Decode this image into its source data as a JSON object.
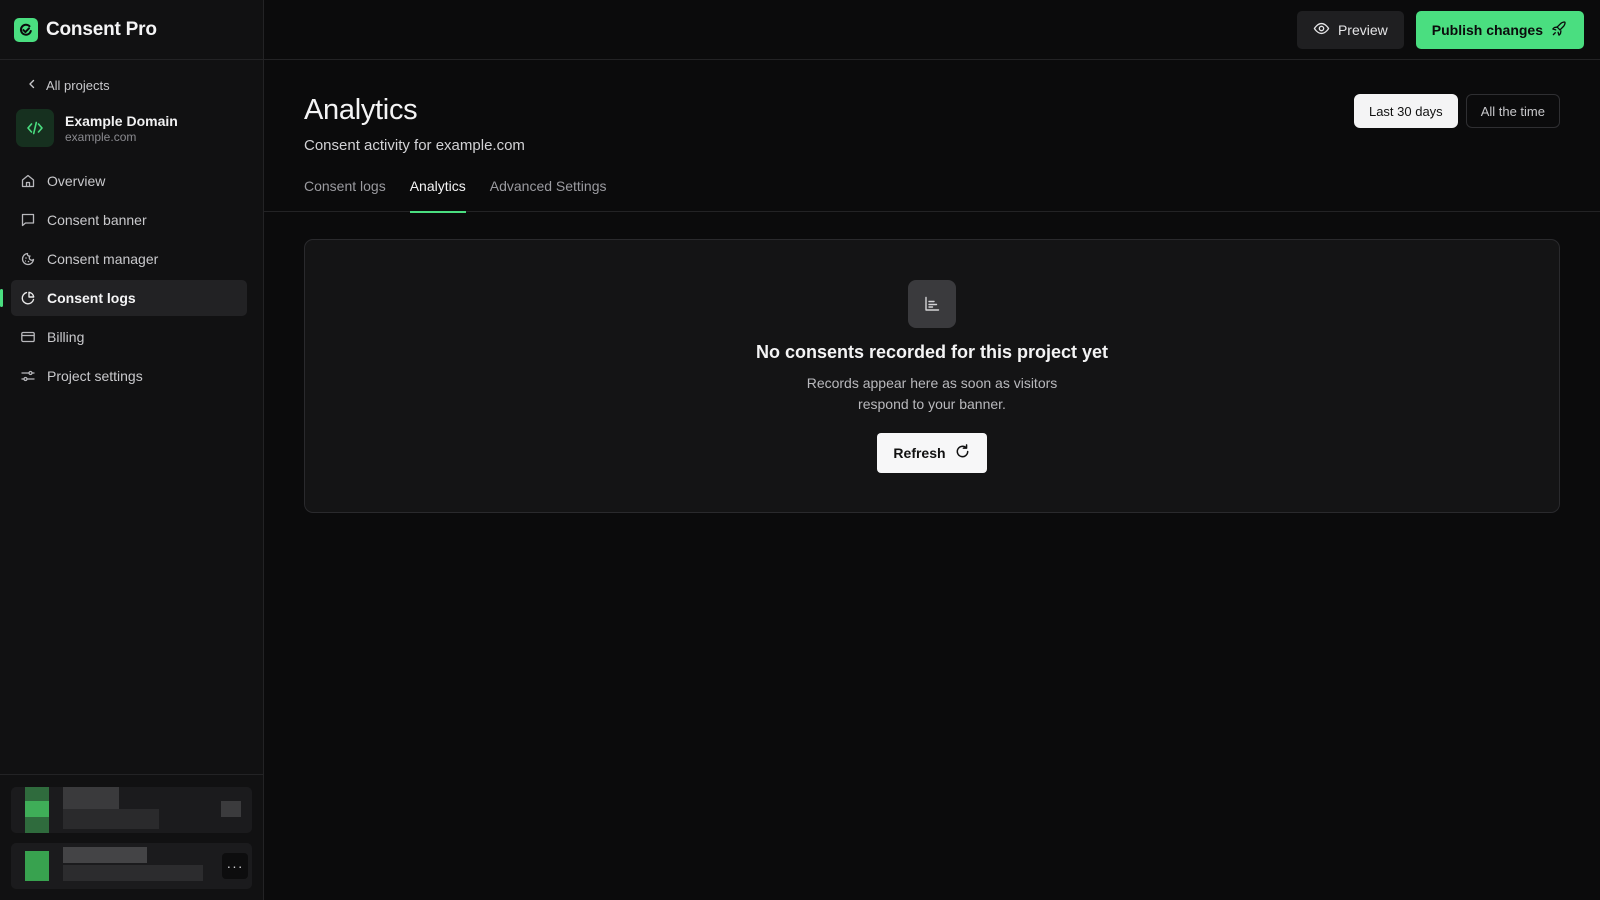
{
  "app": {
    "name": "Consent Pro"
  },
  "sidebar": {
    "back_label": "All projects",
    "project": {
      "name": "Example Domain",
      "domain": "example.com"
    },
    "items": [
      {
        "label": "Overview",
        "icon": "home-icon",
        "active": false
      },
      {
        "label": "Consent banner",
        "icon": "message-square-icon",
        "active": false
      },
      {
        "label": "Consent manager",
        "icon": "cookie-icon",
        "active": false
      },
      {
        "label": "Consent logs",
        "icon": "pie-chart-icon",
        "active": true
      },
      {
        "label": "Billing",
        "icon": "credit-card-icon",
        "active": false
      },
      {
        "label": "Project settings",
        "icon": "sliders-icon",
        "active": false
      }
    ],
    "footer": {
      "more_label": "···"
    }
  },
  "topbar": {
    "preview_label": "Preview",
    "publish_label": "Publish changes"
  },
  "header": {
    "title": "Analytics",
    "subtitle": "Consent activity for example.com",
    "ranges": [
      {
        "label": "Last 30 days",
        "selected": true
      },
      {
        "label": "All the time",
        "selected": false
      }
    ]
  },
  "tabs": [
    {
      "label": "Consent logs",
      "active": false
    },
    {
      "label": "Analytics",
      "active": true
    },
    {
      "label": "Advanced Settings",
      "active": false
    }
  ],
  "empty_state": {
    "icon": "chart-icon",
    "title": "No consents recorded for this project yet",
    "description": "Records appear here as soon as visitors respond to your banner.",
    "refresh_label": "Refresh"
  },
  "colors": {
    "accent": "#4ade80",
    "background": "#0b0b0c",
    "sidebar": "#111112"
  }
}
